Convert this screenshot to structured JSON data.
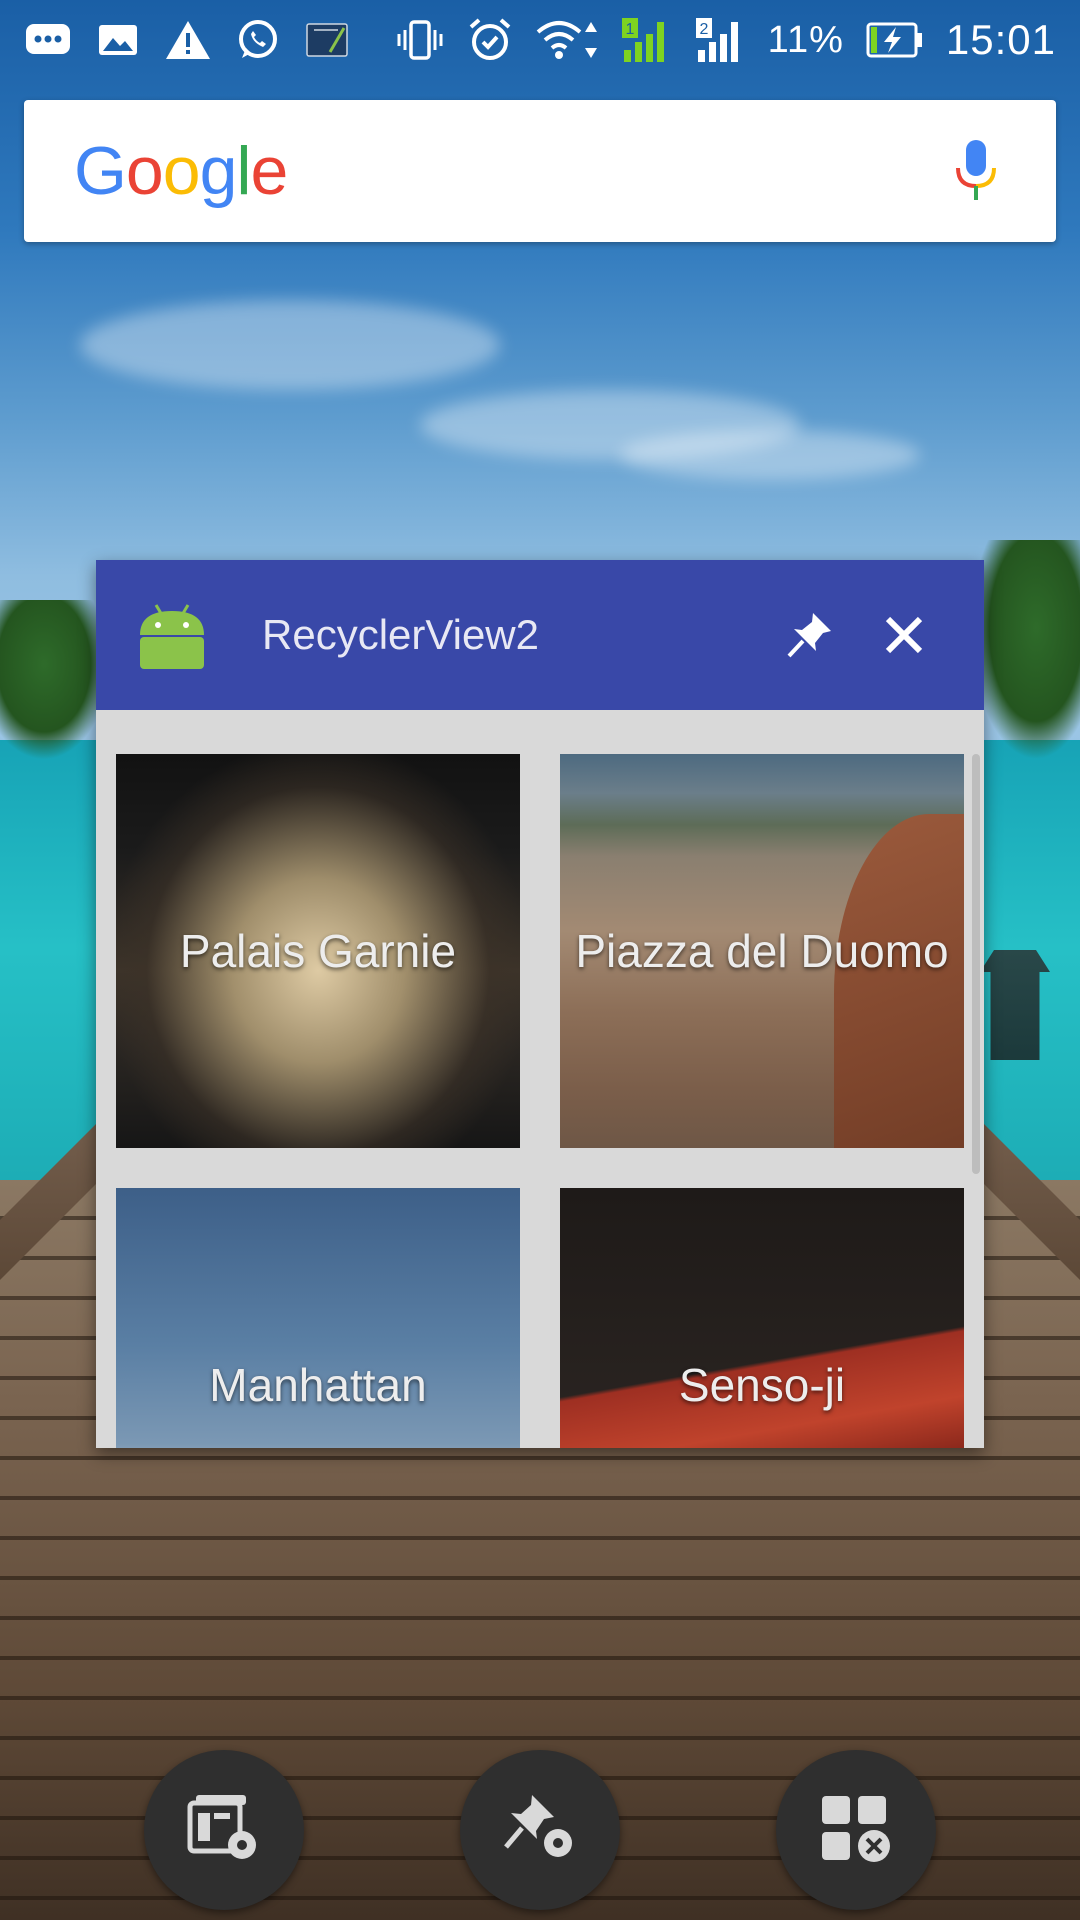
{
  "status_bar": {
    "battery_percent": "11%",
    "time": "15:01",
    "left_icons": [
      "message-icon",
      "gallery-icon",
      "warning-icon",
      "whatsapp-icon",
      "notebook-icon"
    ],
    "right_icons": [
      "vibrate-icon",
      "alarm-icon",
      "wifi-icon",
      "signal-sim1-icon",
      "signal-sim2-icon",
      "battery-charging-icon"
    ],
    "sim1_label": "1",
    "sim2_label": "2"
  },
  "search_widget": {
    "logo_letters": [
      "G",
      "o",
      "o",
      "g",
      "l",
      "e"
    ],
    "logo_colors": [
      "#4285F4",
      "#EA4335",
      "#FBBC05",
      "#4285F4",
      "#34A853",
      "#EA4335"
    ],
    "mic_icon": "mic-icon"
  },
  "floating_window": {
    "title": "RecyclerView2",
    "app_icon": "android-icon",
    "titlebar_color": "#3948a8",
    "pin_icon": "pin-icon",
    "close_icon": "close-icon",
    "tiles": [
      {
        "caption": "Palais Garnie"
      },
      {
        "caption": "Piazza del Duomo"
      },
      {
        "caption": "Manhattan"
      },
      {
        "caption": "Senso-ji"
      }
    ]
  },
  "bottom_actions": {
    "buttons": [
      {
        "icon": "window-settings-icon"
      },
      {
        "icon": "pin-settings-icon"
      },
      {
        "icon": "close-all-windows-icon"
      }
    ]
  }
}
